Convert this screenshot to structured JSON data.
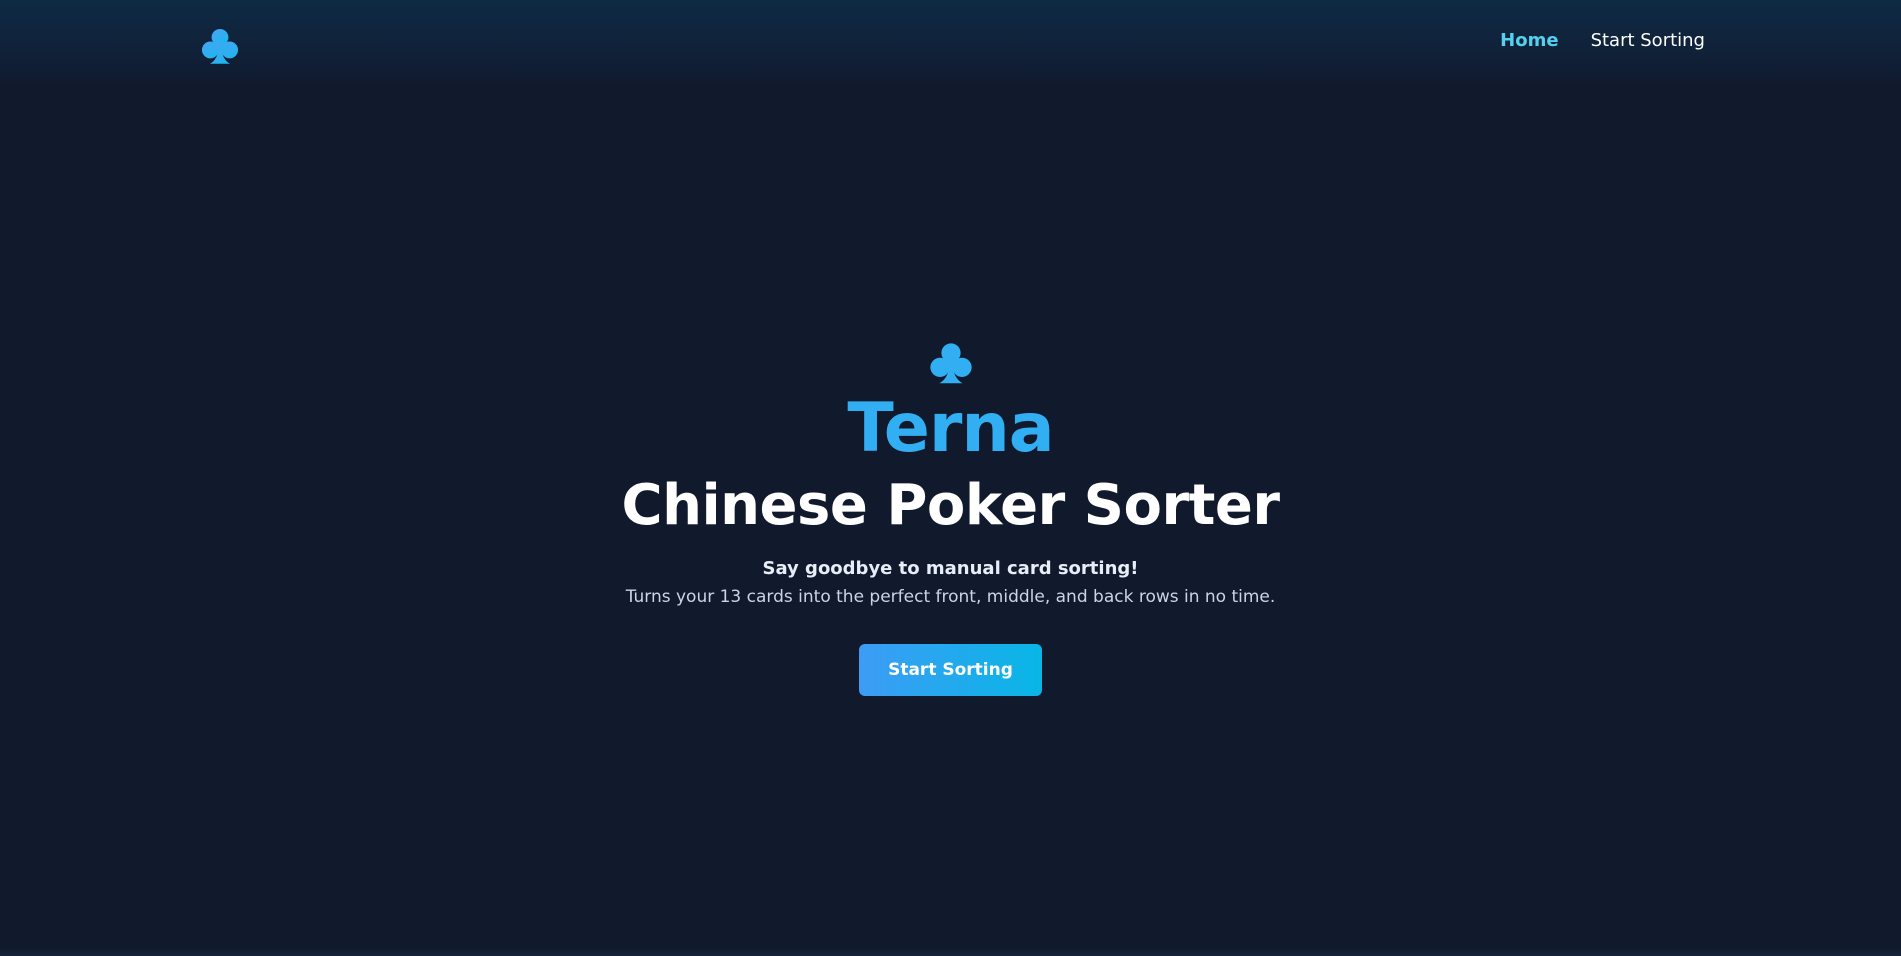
{
  "header": {
    "logo_icon": "club-icon",
    "nav": {
      "home_label": "Home",
      "start_sorting_label": "Start Sorting"
    }
  },
  "hero": {
    "icon": "club-icon",
    "brand": "Terna",
    "headline": "Chinese Poker Sorter",
    "tagline": "Say goodbye to manual card sorting!",
    "description": "Turns your 13 cards into the perfect front, middle, and back rows in no time.",
    "cta_label": "Start Sorting"
  },
  "colors": {
    "background": "#111a2d",
    "accent": "#32aef2",
    "nav_active": "#55d1f0",
    "button_gradient_start": "#3d9cf5",
    "button_gradient_end": "#08b6e6"
  }
}
